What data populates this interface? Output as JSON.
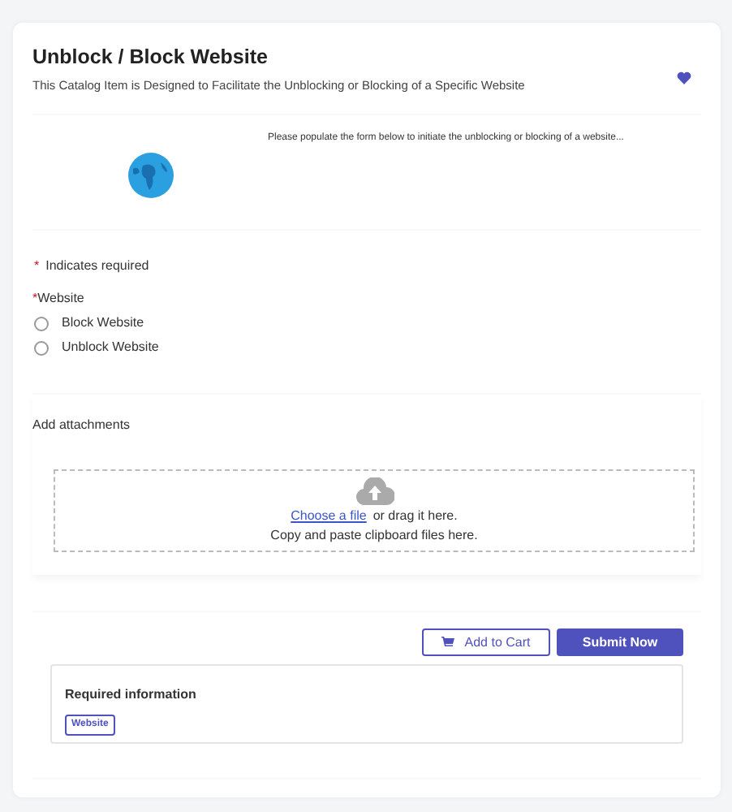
{
  "header": {
    "title": "Unblock / Block Website",
    "subtitle": "This Catalog Item is Designed to Facilitate the Unblocking or Blocking of a Specific Website"
  },
  "intro": {
    "description": "Please populate the form below to initiate the unblocking or blocking of a website..."
  },
  "form": {
    "note_mark": "*",
    "required_note": "Indicates required",
    "field": {
      "required_mark": "*",
      "label": "Website",
      "options": [
        {
          "label": "Block Website",
          "selected": false
        },
        {
          "label": "Unblock Website",
          "selected": false
        }
      ]
    }
  },
  "attachments": {
    "label": "Add attachments",
    "link": "Choose a file",
    "link_suffix": "or drag it here.",
    "hint": "Copy and paste clipboard files here."
  },
  "actions": {
    "buttons": [
      {
        "label": "Add to Cart",
        "kind": "secondary"
      },
      {
        "label": "Submit Now",
        "kind": "primary"
      }
    ]
  },
  "required_info": {
    "title": "Required information",
    "tags": [
      "Website"
    ]
  }
}
